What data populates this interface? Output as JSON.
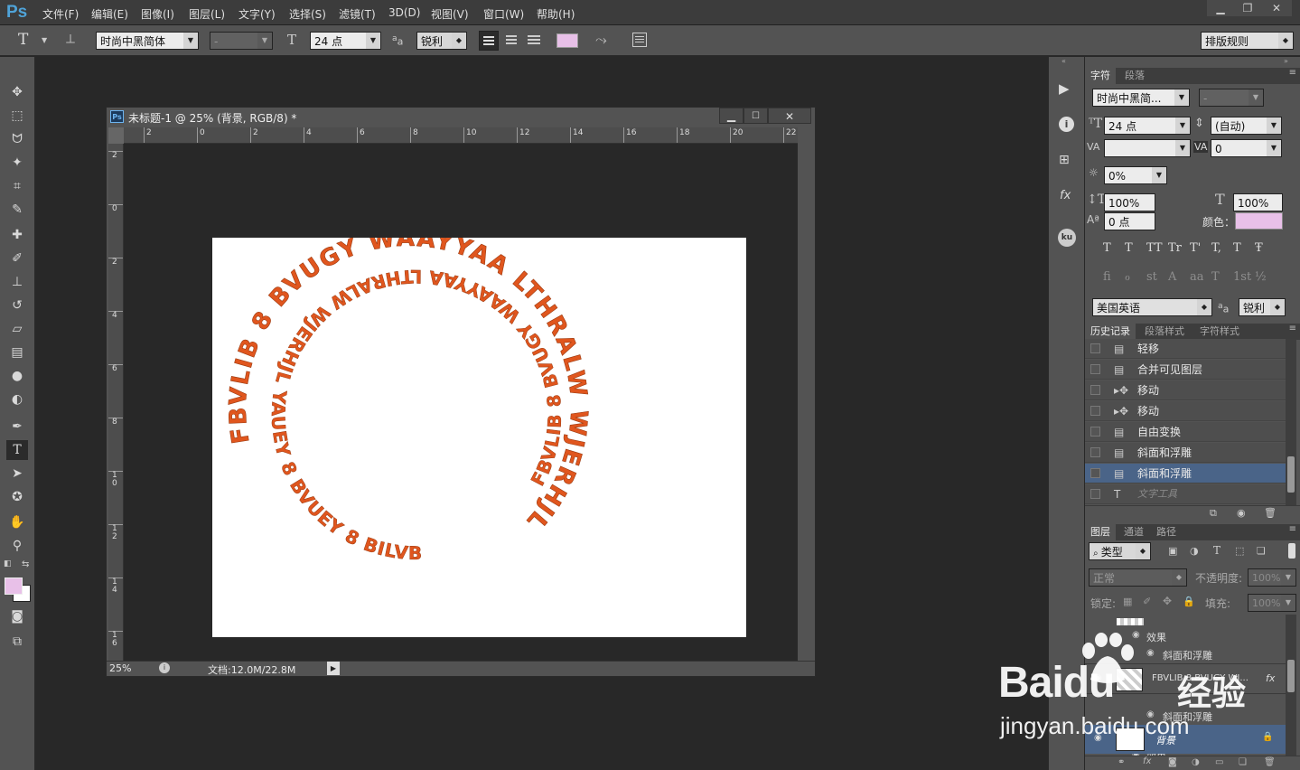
{
  "app": {
    "logo": "Ps"
  },
  "menu": [
    "文件(F)",
    "编辑(E)",
    "图像(I)",
    "图层(L)",
    "文字(Y)",
    "选择(S)",
    "滤镜(T)",
    "3D(D)",
    "视图(V)",
    "窗口(W)",
    "帮助(H)"
  ],
  "options": {
    "tool_glyph": "T",
    "font_family": "时尚中黑简体",
    "font_style": "-",
    "font_size": "24 点",
    "aa_icon": "a",
    "antialias": "锐利",
    "color_swatch": "#e8c0e8",
    "composer": "排版规则"
  },
  "document": {
    "title": "未标题-1 @ 25% (背景, RGB/8) *",
    "zoom": "25%",
    "doc_info": "文档:12.0M/22.8M",
    "ruler_h": [
      "2",
      "0",
      "2",
      "4",
      "6",
      "8",
      "10",
      "12",
      "14",
      "16",
      "18",
      "20",
      "22"
    ],
    "ruler_v": [
      "2",
      "0",
      "2",
      "4",
      "6",
      "8",
      "1\n0",
      "1\n2",
      "1\n4",
      "1\n6"
    ],
    "outer_text": "FBVLIB 8 BVUGY WAAYYAA LTHRALW WJERHJL",
    "inner_text": "FBVLIB 8 BVUGY WAAYYAA LTHRALW WJERHJL YAUEY 8 BVUEY 8 BILVB",
    "text_color": "#e0561e"
  },
  "character_panel": {
    "tabs": [
      "字符",
      "段落"
    ],
    "font_family": "时尚中黑简...",
    "font_style": "-",
    "font_size": "24 点",
    "leading": "(自动)",
    "kerning": "",
    "tracking": "0",
    "tsume": "0%",
    "vscale": "100%",
    "hscale": "100%",
    "baseline": "0 点",
    "color_label": "颜色：",
    "color": "#e8c0e8",
    "style_buttons": [
      "T",
      "T",
      "TT",
      "Tr",
      "T'",
      "T,",
      "T",
      "Ŧ"
    ],
    "opentype_buttons": [
      "fi",
      "ℴ",
      "st",
      "A",
      "aa",
      "T",
      "1st",
      "½"
    ],
    "language": "美国英语",
    "aa_label": "a",
    "antialias": "锐利"
  },
  "history_panel": {
    "tabs": [
      "历史记录",
      "段落样式",
      "字符样式"
    ],
    "items": [
      {
        "icon": "doc",
        "label": "轻移"
      },
      {
        "icon": "doc",
        "label": "合并可见图层"
      },
      {
        "icon": "move",
        "label": "移动"
      },
      {
        "icon": "move",
        "label": "移动"
      },
      {
        "icon": "doc",
        "label": "自由变换"
      },
      {
        "icon": "doc",
        "label": "斜面和浮雕"
      },
      {
        "icon": "doc",
        "label": "斜面和浮雕"
      },
      {
        "icon": "type",
        "label": "文字工具"
      }
    ],
    "selected_index": 6
  },
  "layers_panel": {
    "tabs": [
      "图层",
      "通道",
      "路径"
    ],
    "filter": "类型",
    "blend_mode": "正常",
    "opacity_label": "不透明度:",
    "opacity": "100%",
    "lock_label": "锁定:",
    "fill_label": "填充:",
    "fill": "100%",
    "rows": {
      "effects_1": "效果",
      "bevel_1": "斜面和浮雕",
      "text_layer": "FBVLIB 8 BVUGY WJ...",
      "fx": "fx",
      "effects_2": "效果",
      "bevel_2": "斜面和浮雕",
      "background": "背景"
    }
  },
  "watermark": {
    "brand": "Baidu",
    "cn": "经验",
    "url": "jingyan.baidu.com"
  }
}
